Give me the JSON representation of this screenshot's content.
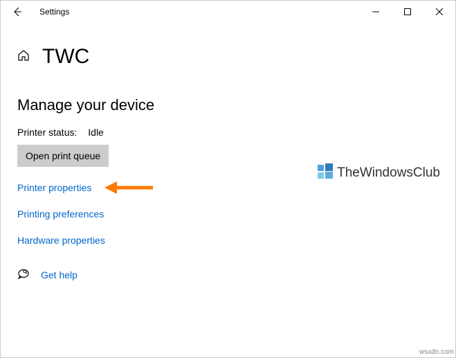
{
  "titlebar": {
    "title": "Settings"
  },
  "header": {
    "page_title": "TWC"
  },
  "section": {
    "heading": "Manage your device"
  },
  "status": {
    "label": "Printer status:",
    "value": "Idle"
  },
  "buttons": {
    "open_queue": "Open print queue"
  },
  "links": {
    "printer_properties": "Printer properties",
    "printing_preferences": "Printing preferences",
    "hardware_properties": "Hardware properties",
    "get_help": "Get help"
  },
  "watermark": {
    "text": "TheWindowsClub"
  },
  "source": {
    "text": "wsxdn.com"
  }
}
